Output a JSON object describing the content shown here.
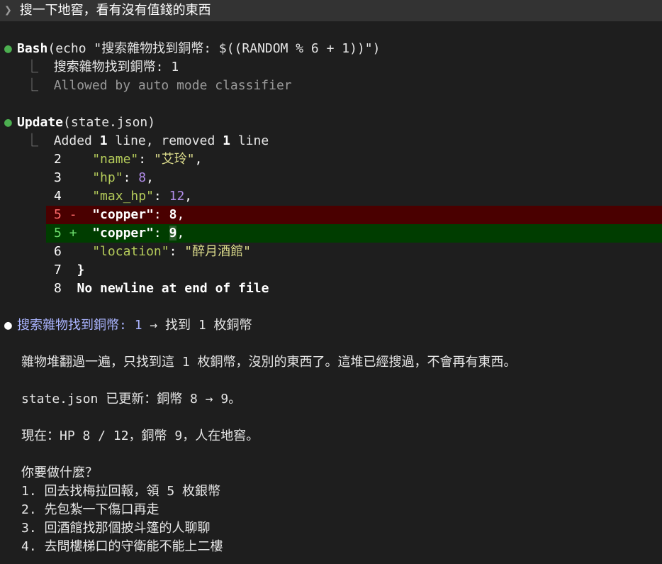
{
  "prompt": {
    "chevron": "❯",
    "text": "搜一下地窖，看有沒有值錢的東西"
  },
  "bash_block": {
    "tool": "Bash",
    "args": "(echo \"搜索雜物找到銅幣: $((RANDOM % 6 + 1))\")",
    "output_line": "搜索雜物找到銅幣: 1",
    "status_line": "Allowed by auto mode classifier"
  },
  "update_block": {
    "tool": "Update",
    "args": "(state.json)",
    "summary_parts": [
      "Added ",
      "1",
      " line, removed ",
      "1",
      " line"
    ],
    "diff": [
      {
        "ln": "2",
        "mark": " ",
        "key": "\"name\"",
        "sep": ": ",
        "val": "\"艾玲\"",
        "val_type": "str",
        "end": ","
      },
      {
        "ln": "3",
        "mark": " ",
        "key": "\"hp\"",
        "sep": ": ",
        "val": "8",
        "val_type": "num",
        "end": ","
      },
      {
        "ln": "4",
        "mark": " ",
        "key": "\"max_hp\"",
        "sep": ": ",
        "val": "12",
        "val_type": "num",
        "end": ","
      },
      {
        "ln": "5",
        "mark": "-",
        "key": "\"copper\"",
        "sep": ": ",
        "val": "8",
        "val_type": "plain",
        "end": ","
      },
      {
        "ln": "5",
        "mark": "+",
        "key": "\"copper\"",
        "sep": ": ",
        "val": "9",
        "val_type": "plain",
        "end": ","
      },
      {
        "ln": "6",
        "mark": " ",
        "key": "\"location\"",
        "sep": ": ",
        "val": "\"醉月酒館\"",
        "val_type": "str",
        "end": ""
      },
      {
        "ln": "7",
        "mark": " ",
        "text": "}"
      },
      {
        "ln": "8",
        "mark": " ",
        "text": "No newline at end of file"
      }
    ]
  },
  "response": {
    "headline_prefix": "搜索雜物找到銅幣: ",
    "headline_num": "1",
    "headline_arrow": " → ",
    "headline_rest": "找到 1 枚銅幣",
    "para1": "雜物堆翻過一遍，只找到這 1 枚銅幣，沒別的東西了。這堆已經搜過，不會再有東西。",
    "para2": "state.json 已更新：銅幣 8 → 9。",
    "para3": "現在：HP 8 / 12，銅幣 9，人在地窖。",
    "question": "你要做什麼？",
    "options": [
      "1. 回去找梅拉回報，領 5 枚銀幣",
      "2. 先包紮一下傷口再走",
      "3. 回酒館找那個披斗篷的人聊聊",
      "4. 去問樓梯口的守衛能不能上二樓"
    ]
  },
  "glyphs": {
    "bullet": "●",
    "elbow": "⎿"
  },
  "colors": {
    "background": "#1e1e1e",
    "prompt_bar": "#333333",
    "success_dot": "#4caf50",
    "diff_removed_bg": "#4a0000",
    "diff_added_bg": "#003d00",
    "json_key": "#b5cc5a",
    "json_string": "#dcdc8c",
    "json_number": "#b08ce8",
    "headline": "#aab4ff"
  }
}
